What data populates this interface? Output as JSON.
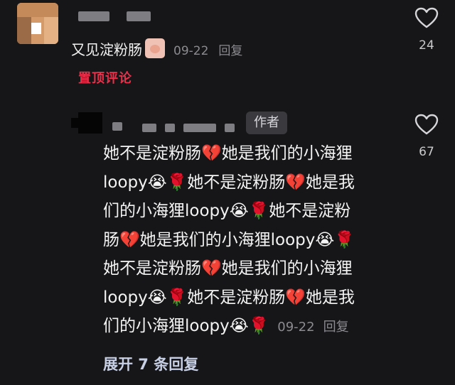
{
  "top_comment": {
    "text": "又见淀粉肠",
    "sticker": "sticker-face",
    "date": "09-22",
    "reply_label": "回复",
    "pin_label": "置顶评论",
    "like_count": "24"
  },
  "reply": {
    "author_badge": "作者",
    "lines": [
      "她不是淀粉肠💔她是我们的小海狸",
      "loopy😭🌹她不是淀粉肠💔她是我",
      "们的小海狸loopy😭🌹她不是淀粉",
      "肠💔她是我们的小海狸loopy😭🌹",
      "她不是淀粉肠💔她是我们的小海狸",
      "loopy😭🌹她不是淀粉肠💔她是我",
      "们的小海狸loopy😭🌹"
    ],
    "date": "09-22",
    "reply_label": "回复",
    "like_count": "67"
  },
  "expand_label": "展开 7 条回复",
  "colors": {
    "background": "#161618",
    "pin_red": "#e8304a",
    "muted": "#8b8b90",
    "link": "#c8d0e6"
  }
}
